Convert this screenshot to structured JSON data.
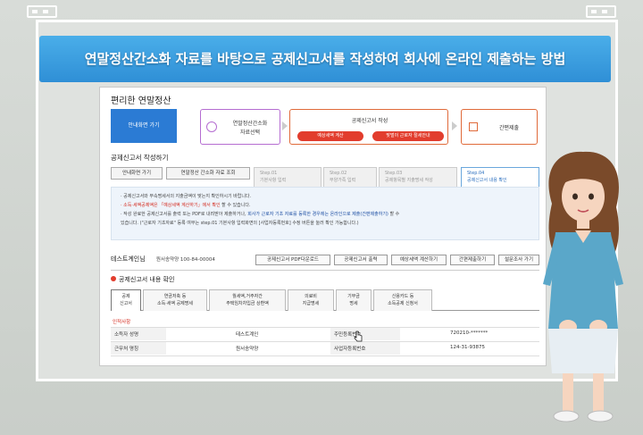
{
  "banner": {
    "title": "연말정산간소화 자료를 바탕으로 공제신고서를 작성하여 회사에 온라인 제출하는 방법"
  },
  "app": {
    "title": "편리한 연말정산",
    "start_button": "안내화면 가기",
    "flow": {
      "step1_line1": "연말정산간소화",
      "step1_line2": "자료선택",
      "step2_title": "공제신고서 작성",
      "step2_pill_a": "예상세액 계산",
      "step2_pill_b": "맞벌이 근로자 절세안내",
      "step3_title": "간편제출"
    },
    "section_title": "공제신고서 작성하기",
    "buttons": {
      "guide": "안내화면 가기",
      "lookup": "연말정산 간소화 자료 조회"
    },
    "steps": [
      {
        "num": "Step.01",
        "label": "기본사항 입력"
      },
      {
        "num": "Step.02",
        "label": "부양가족 입력"
      },
      {
        "num": "Step.03",
        "label": "공제항목별 지출명세 작성"
      },
      {
        "num": "Step.04",
        "label": "공제신고서 내용 확인"
      }
    ],
    "notice": {
      "line1": "· 공제신고서와 부속명세서의 지출금액이 맞는지 확인하시기 바랍니다.",
      "line2_red": "· 소득·세액공제액은 「예상세액 계산하기」에서 확인",
      "line2_rest": "할 수 있습니다.",
      "line3": "· 작성 완료한 공제신고서를 출력 또는 PDF로 내려받아 제출하거나,",
      "line3_blue": "회사가 근로자 기초 자료를 등록한 경우에는 온라인으로 제출(간편제출하기)",
      "line3_end": "할 수",
      "line4": "있습니다. (\"근로자 기초자료\" 등록 여부는 step.01 기본사항 입력화면의 [사업자등록번호] 수정 버튼을 눌러 확인 가능합니다.)"
    },
    "info": {
      "name": "테스트계인님",
      "company_label": "원서송약양 100-84-00004"
    },
    "actions": [
      "공제신고서 PDF다운로드",
      "공제신고서 출력",
      "예상세액 계산하기",
      "간편제출하기",
      "설문조사 가기"
    ],
    "confirm_title": "공제신고서 내용 확인",
    "tabs": [
      {
        "line1": "공제",
        "line2": "신고서"
      },
      {
        "line1": "연금저축 등",
        "line2": "소득·세액 공제명세"
      },
      {
        "line1": "월세액,거주자간",
        "line2": "주택임차차입금 상환액"
      },
      {
        "line1": "의료비",
        "line2": "지급명세"
      },
      {
        "line1": "기부금",
        "line2": "명세"
      },
      {
        "line1": "신용카드 등",
        "line2": "소득공제 신청서"
      }
    ],
    "personal_title": "인적사항",
    "rows": [
      {
        "k1": "소득자 성명",
        "v1": "테스트계인",
        "k2": "주민등록번호",
        "v2": "720210-*******"
      },
      {
        "k1": "근무처 명칭",
        "v1": "원서송약양",
        "k2": "사업자등록번호",
        "v2": "124-31-93875"
      }
    ]
  },
  "colors": {
    "banner": "#2f8fd6",
    "accent_blue": "#2b7bd4",
    "accent_red": "#e23d2d"
  }
}
